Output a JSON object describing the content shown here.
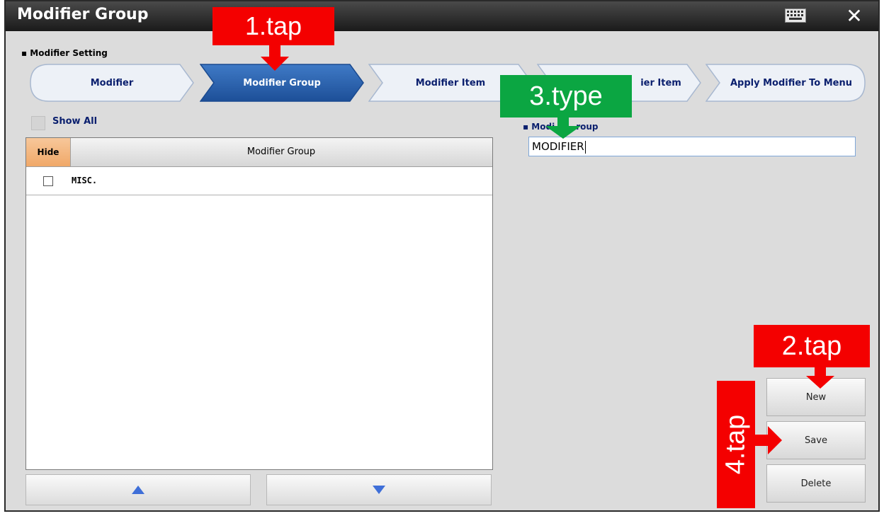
{
  "window": {
    "title": "Modifier Group",
    "close_glyph": "✕",
    "keyboard_icon": "keyboard-icon"
  },
  "section_label": "▪ Modifier Setting",
  "steps": [
    {
      "label": "Modifier",
      "active": false
    },
    {
      "label": "Modifier Group",
      "active": true
    },
    {
      "label": "Modifier Item",
      "active": false
    },
    {
      "label": "ier Item",
      "active": false
    },
    {
      "label": "Apply Modifier To Menu",
      "active": false
    }
  ],
  "show_all_label": "Show All",
  "grid": {
    "headers": {
      "hide": "Hide",
      "name": "Modifier Group"
    },
    "rows": [
      {
        "name": "MISC.",
        "hidden": false
      }
    ]
  },
  "form": {
    "label": "▪ Modi",
    "label_tail": "roup",
    "value": "MODIFIER"
  },
  "buttons": {
    "new": "New",
    "save": "Save",
    "delete": "Delete"
  },
  "annotations": {
    "a1": "1.tap",
    "a2": "2.tap",
    "a3": "3.type",
    "a4": "4.tap"
  },
  "colors": {
    "active_step": "#2b63b0",
    "annotation_red": "#f40000",
    "annotation_green": "#0ba642",
    "header_orange": "#f0a868"
  }
}
